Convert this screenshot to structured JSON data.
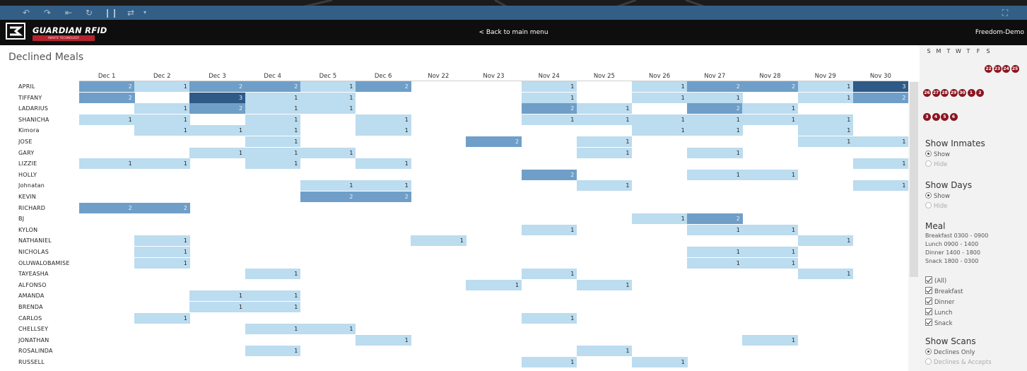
{
  "app": {
    "brand": "GUARDIAN RFID",
    "brand_tagline": "INMATE TECHNOLOGY",
    "back_link": "< Back to main menu",
    "user": "Freedom-Demo",
    "toolbar_icons": [
      "undo-icon",
      "redo-icon",
      "revert-icon",
      "refresh-icon",
      "pause-icon",
      "share-icon",
      "fullscreen-icon"
    ]
  },
  "page": {
    "title": "Declined Meals"
  },
  "table": {
    "columns": [
      "Dec 1",
      "Dec 2",
      "Dec 3",
      "Dec 4",
      "Dec 5",
      "Dec 6",
      "Nov 22",
      "Nov 23",
      "Nov 24",
      "Nov 25",
      "Nov 26",
      "Nov 27",
      "Nov 28",
      "Nov 29",
      "Nov 30"
    ],
    "rows": [
      {
        "name": "APRIL",
        "values": [
          2,
          1,
          2,
          2,
          1,
          2,
          null,
          null,
          1,
          null,
          1,
          2,
          2,
          1,
          3
        ]
      },
      {
        "name": "TIFFANY",
        "values": [
          2,
          null,
          3,
          1,
          1,
          null,
          null,
          null,
          1,
          null,
          1,
          1,
          null,
          1,
          2
        ]
      },
      {
        "name": "LADARIUS",
        "values": [
          null,
          1,
          2,
          1,
          1,
          null,
          null,
          null,
          2,
          1,
          null,
          2,
          1,
          null,
          null
        ]
      },
      {
        "name": "SHANICHA",
        "values": [
          1,
          1,
          null,
          1,
          null,
          1,
          null,
          null,
          1,
          1,
          1,
          1,
          1,
          1,
          null
        ]
      },
      {
        "name": "Kimora",
        "values": [
          null,
          1,
          1,
          1,
          null,
          1,
          null,
          null,
          null,
          null,
          1,
          1,
          null,
          1,
          null
        ]
      },
      {
        "name": "JOSE",
        "values": [
          null,
          null,
          null,
          1,
          null,
          null,
          null,
          2,
          null,
          1,
          null,
          null,
          null,
          1,
          1
        ]
      },
      {
        "name": "GARY",
        "values": [
          null,
          null,
          1,
          1,
          1,
          null,
          null,
          null,
          null,
          1,
          null,
          1,
          null,
          null,
          null
        ]
      },
      {
        "name": "LIZZIE",
        "values": [
          1,
          1,
          null,
          1,
          null,
          1,
          null,
          null,
          null,
          null,
          null,
          null,
          null,
          null,
          1
        ]
      },
      {
        "name": "HOLLY",
        "values": [
          null,
          null,
          null,
          null,
          null,
          null,
          null,
          null,
          2,
          null,
          null,
          1,
          1,
          null,
          null
        ]
      },
      {
        "name": "Johnatan",
        "values": [
          null,
          null,
          null,
          null,
          1,
          1,
          null,
          null,
          null,
          1,
          null,
          null,
          null,
          null,
          1
        ]
      },
      {
        "name": "KEVIN",
        "values": [
          null,
          null,
          null,
          null,
          2,
          2,
          null,
          null,
          null,
          null,
          null,
          null,
          null,
          null,
          null
        ]
      },
      {
        "name": "RICHARD",
        "values": [
          2,
          2,
          null,
          null,
          null,
          null,
          null,
          null,
          null,
          null,
          null,
          null,
          null,
          null,
          null
        ]
      },
      {
        "name": "BJ",
        "values": [
          null,
          null,
          null,
          null,
          null,
          null,
          null,
          null,
          null,
          null,
          1,
          2,
          null,
          null,
          null
        ]
      },
      {
        "name": "KYLON",
        "values": [
          null,
          null,
          null,
          null,
          null,
          null,
          null,
          null,
          1,
          null,
          null,
          1,
          1,
          null,
          null
        ]
      },
      {
        "name": "NATHANIEL",
        "values": [
          null,
          1,
          null,
          null,
          null,
          null,
          1,
          null,
          null,
          null,
          null,
          null,
          null,
          1,
          null
        ]
      },
      {
        "name": "NICHOLAS",
        "values": [
          null,
          1,
          null,
          null,
          null,
          null,
          null,
          null,
          null,
          null,
          null,
          1,
          1,
          null,
          null
        ]
      },
      {
        "name": "OLUWALOBAMISE",
        "values": [
          null,
          1,
          null,
          null,
          null,
          null,
          null,
          null,
          null,
          null,
          null,
          1,
          1,
          null,
          null
        ]
      },
      {
        "name": "TAYEASHA",
        "values": [
          null,
          null,
          null,
          1,
          null,
          null,
          null,
          null,
          1,
          null,
          null,
          null,
          null,
          1,
          null
        ]
      },
      {
        "name": "ALFONSO",
        "values": [
          null,
          null,
          null,
          null,
          null,
          null,
          null,
          1,
          null,
          1,
          null,
          null,
          null,
          null,
          null
        ]
      },
      {
        "name": "AMANDA",
        "values": [
          null,
          null,
          1,
          1,
          null,
          null,
          null,
          null,
          null,
          null,
          null,
          null,
          null,
          null,
          null
        ]
      },
      {
        "name": "BRENDA",
        "values": [
          null,
          null,
          1,
          1,
          null,
          null,
          null,
          null,
          null,
          null,
          null,
          null,
          null,
          null,
          null
        ]
      },
      {
        "name": "CARLOS",
        "values": [
          null,
          1,
          null,
          null,
          null,
          null,
          null,
          null,
          1,
          null,
          null,
          null,
          null,
          null,
          null
        ]
      },
      {
        "name": "CHELLSEY",
        "values": [
          null,
          null,
          null,
          1,
          1,
          null,
          null,
          null,
          null,
          null,
          null,
          null,
          null,
          null,
          null
        ]
      },
      {
        "name": "JONATHAN",
        "values": [
          null,
          null,
          null,
          null,
          null,
          1,
          null,
          null,
          null,
          null,
          null,
          null,
          1,
          null,
          null
        ]
      },
      {
        "name": "ROSALINDA",
        "values": [
          null,
          null,
          null,
          1,
          null,
          null,
          null,
          null,
          null,
          1,
          null,
          null,
          null,
          null,
          null
        ]
      },
      {
        "name": "RUSSELL",
        "values": [
          null,
          null,
          null,
          null,
          null,
          null,
          null,
          null,
          1,
          null,
          1,
          null,
          null,
          null,
          null
        ]
      }
    ],
    "colors": {
      "1": "#bcdcef",
      "2": "#6f9fc8",
      "3": "#2e5a87"
    }
  },
  "calendar": {
    "weekdays": [
      "S",
      "M",
      "T",
      "W",
      "T",
      "F",
      "S"
    ],
    "weeks": [
      [
        null,
        null,
        null,
        "22",
        "23",
        "24",
        "25"
      ],
      [
        "26",
        "27",
        "28",
        "29",
        "30",
        "1",
        "2"
      ],
      [
        "3",
        "4",
        "5",
        "6",
        null,
        null,
        null
      ]
    ]
  },
  "sidebar": {
    "show_inmates": {
      "title": "Show Inmates",
      "options": [
        "Show",
        "Hide"
      ],
      "selected": "Show"
    },
    "show_days": {
      "title": "Show Days",
      "options": [
        "Show",
        "Hide"
      ],
      "selected": "Show"
    },
    "meal": {
      "title": "Meal",
      "times": [
        "Breakfast  0300 - 0900",
        "Lunch  0900 - 1400",
        "Dinner  1400 - 1800",
        "Snack  1800 - 0300"
      ],
      "filters": [
        "(All)",
        "Breakfast",
        "Dinner",
        "Lunch",
        "Snack"
      ]
    },
    "show_scans": {
      "title": "Show Scans",
      "options": [
        "Declines Only",
        "Declines & Accepts"
      ],
      "selected": "Declines Only"
    }
  }
}
